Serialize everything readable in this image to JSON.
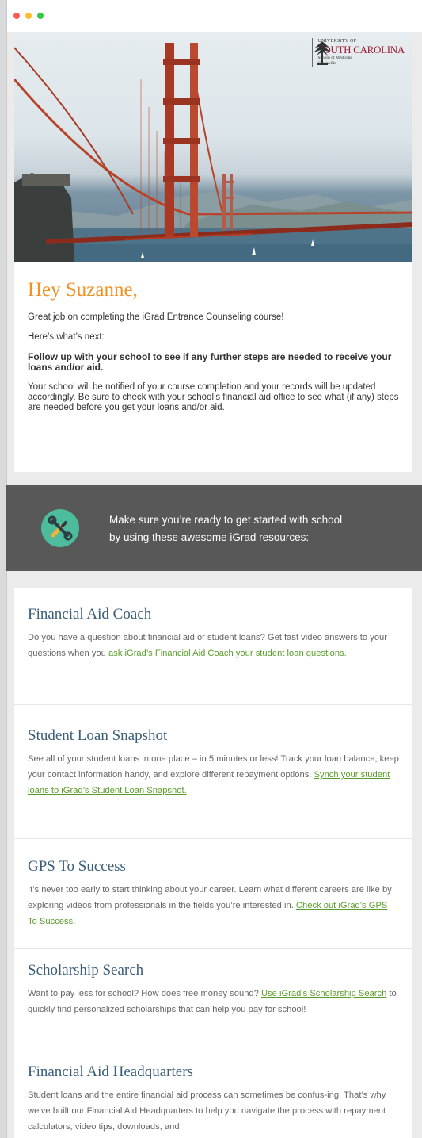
{
  "window": {
    "controls": [
      "close",
      "minimize",
      "maximize"
    ]
  },
  "logo": {
    "line1": "UNIVERSITY OF",
    "line2": "SOUTH CAROLINA",
    "line3": "School of Medicine",
    "line4": "Greenville",
    "icon": "palmetto-seal-icon"
  },
  "hero": {
    "icon": "golden-gate-bridge-photo"
  },
  "greeting": "Hey Suzanne,",
  "intro": {
    "p1": "Great job on completing the iGrad Entrance Counseling course!",
    "p2": "Here’s what’s next:",
    "p3": "Follow up with your school to see if any further steps are needed to receive your loans and/or aid.",
    "p4": "Your school will be notified of your course completion and your records will be updated accordingly. Be sure to check with your school’s financial aid office to see what (if any) steps are needed before you get your loans and/or aid."
  },
  "banner": {
    "icon": "tools-icon",
    "line1": "Make sure you’re ready to get started with school",
    "line2": "by using these awesome iGrad resources:"
  },
  "resources": [
    {
      "title": "Financial Aid Coach",
      "text_before": "Do you have a question about financial aid or student loans? Get fast video answers to your questions when you ",
      "link": "ask iGrad’s Financial Aid Coach your student loan questions.",
      "text_after": ""
    },
    {
      "title": "Student Loan Snapshot",
      "text_before": "See all of your student loans in one place – in 5 minutes or less! Track your loan balance, keep your contact information handy, and explore different repayment options. ",
      "link": "Synch your student loans to iGrad’s Student Loan Snapshot.",
      "text_after": ""
    },
    {
      "title": "GPS To Success",
      "text_before": "It’s never too early to start thinking about your career. Learn what different careers are like by exploring videos from professionals in the fields you’re interested in. ",
      "link": "Check out iGrad’s GPS To Success.",
      "text_after": ""
    },
    {
      "title": "Scholarship Search",
      "text_before": "Want to pay less for school? How does free money sound? ",
      "link": "Use iGrad’s Scholarship Search",
      "text_after": " to quickly find personalized scholarships that can help you pay for school!"
    },
    {
      "title": "Financial Aid Headquarters",
      "text_before": "Student loans and the entire financial aid process can sometimes be confus-ing. That’s why we’ve built our Financial Aid Headquarters to help you navigate the process with repayment calculators, video tips, downloads, and",
      "link": "",
      "text_after": ""
    }
  ],
  "colors": {
    "greeting": "#f09123",
    "heading": "#3a5e7a",
    "link": "#5a9d2b",
    "banner": "#585858",
    "icon_circle": "#4dbc9d"
  }
}
